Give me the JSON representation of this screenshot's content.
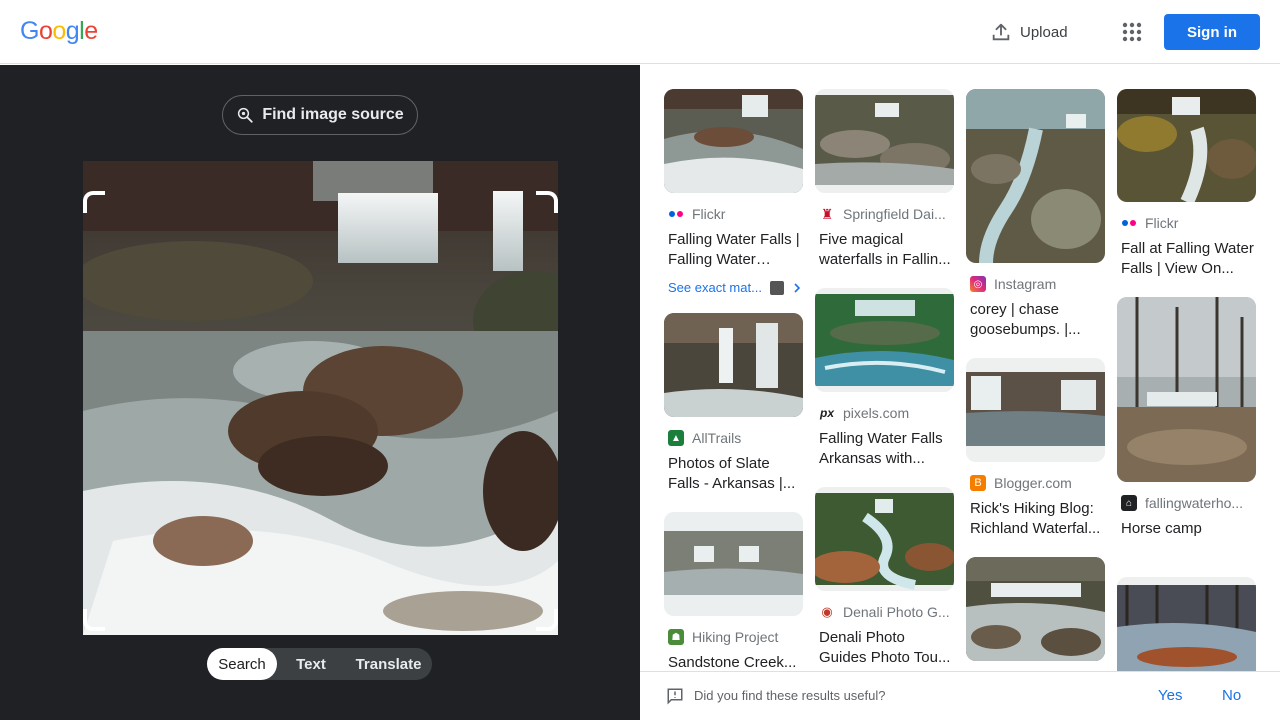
{
  "header": {
    "logo_letters": [
      {
        "ch": "G",
        "color": "#4285F4"
      },
      {
        "ch": "o",
        "color": "#EA4335"
      },
      {
        "ch": "o",
        "color": "#FBBC05"
      },
      {
        "ch": "g",
        "color": "#4285F4"
      },
      {
        "ch": "l",
        "color": "#34A853"
      },
      {
        "ch": "e",
        "color": "#EA4335"
      }
    ],
    "upload_label": "Upload",
    "apps_icon": "apps-grid-icon",
    "signin_label": "Sign in"
  },
  "lens": {
    "find_source_label": "Find image source",
    "tabs": [
      {
        "label": "Search",
        "active": true
      },
      {
        "label": "Text",
        "active": false
      },
      {
        "label": "Translate",
        "active": false
      }
    ]
  },
  "results": {
    "columns": [
      [
        {
          "source": "Flickr",
          "favicon": "flickr",
          "title": "Falling Water Falls | Falling Water Falls...",
          "exact": "See exact mat..."
        },
        {
          "source": "AllTrails",
          "favicon": "alltrails",
          "title": "Photos of Slate Falls - Arkansas |..."
        },
        {
          "source": "Hiking Project",
          "favicon": "hikingproject",
          "title": "Sandstone Creek..."
        }
      ],
      [
        {
          "source": "Springfield Dai...",
          "favicon": "springfield",
          "title": "Five magical waterfalls in Fallin..."
        },
        {
          "source": "pixels.com",
          "favicon": "pixels",
          "title": "Falling Water Falls Arkansas with..."
        },
        {
          "source": "Denali Photo G...",
          "favicon": "denali",
          "title": "Denali Photo Guides Photo Tou..."
        }
      ],
      [
        {
          "source": "Instagram",
          "favicon": "instagram",
          "title": "corey | chase goosebumps. |..."
        },
        {
          "source": "Blogger.com",
          "favicon": "blogger",
          "title": "Rick's Hiking Blog: Richland Waterfal..."
        },
        {
          "source": "",
          "favicon": "",
          "title": ""
        }
      ],
      [
        {
          "source": "Flickr",
          "favicon": "flickr",
          "title": "Fall at Falling Water Falls | View On..."
        },
        {
          "source": "fallingwaterho...",
          "favicon": "fallingwater",
          "title": "Horse camp"
        },
        {
          "source": "",
          "favicon": "",
          "title": ""
        }
      ]
    ]
  },
  "feedback": {
    "question": "Did you find these results useful?",
    "yes": "Yes",
    "no": "No"
  }
}
